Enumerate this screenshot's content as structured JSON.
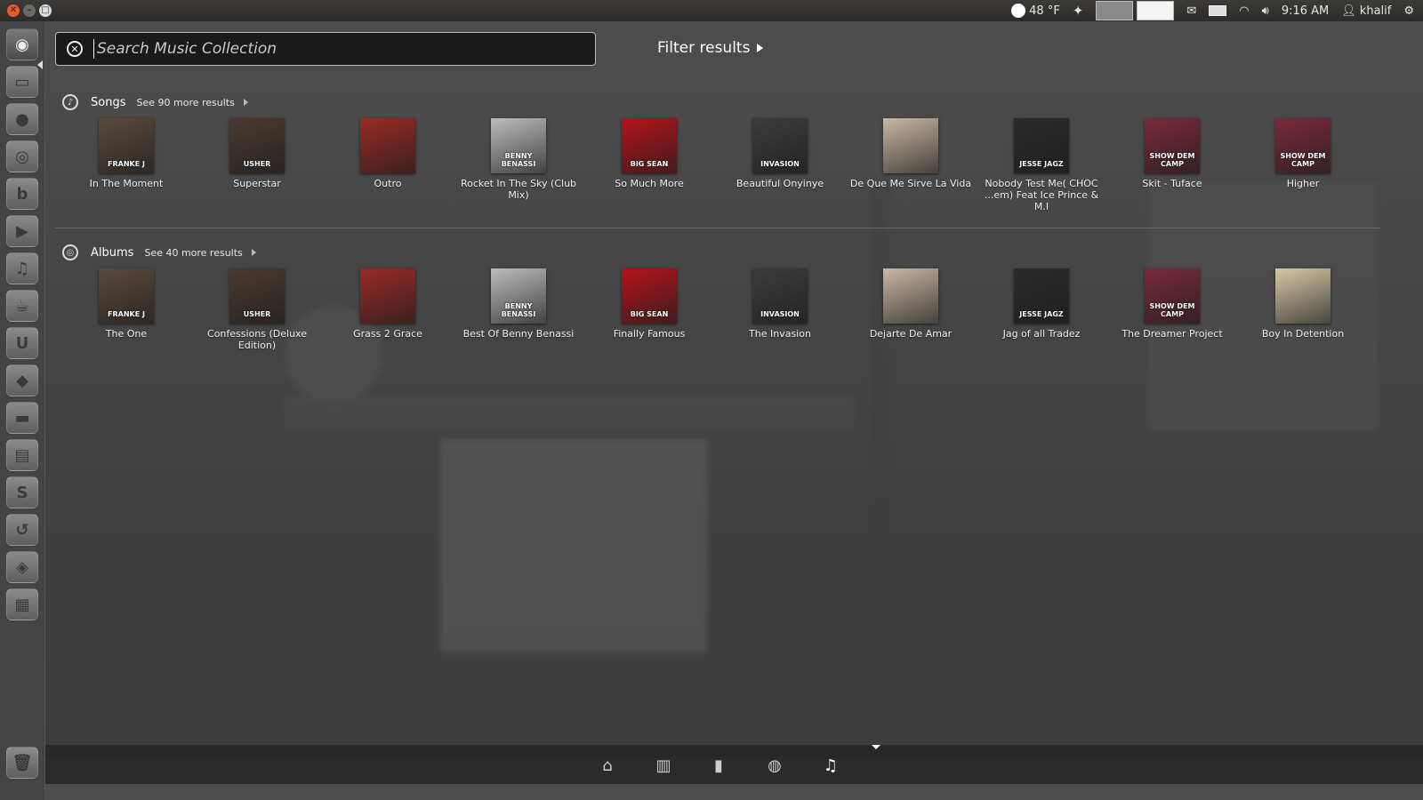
{
  "top_panel": {
    "weather": "48 °F",
    "time": "9:16 AM",
    "user": "khalif"
  },
  "search": {
    "placeholder": "Search Music Collection",
    "value": ""
  },
  "filter_results_label": "Filter results",
  "songs": {
    "title": "Songs",
    "more": "See 90 more results",
    "items": [
      {
        "label": "In The Moment",
        "cover_color": "#5a4a3c",
        "cover_text": "FRANKE J"
      },
      {
        "label": "Superstar",
        "cover_color": "#4a3a30",
        "cover_text": "USHER"
      },
      {
        "label": "Outro",
        "cover_color": "#9a2a24",
        "cover_text": ""
      },
      {
        "label": "Rocket In The Sky (Club Mix)",
        "cover_color": "#bdbdbd",
        "cover_text": "BENNY BENASSI"
      },
      {
        "label": "So Much More",
        "cover_color": "#b3141a",
        "cover_text": "BIG SEAN"
      },
      {
        "label": "Beautiful Onyinye",
        "cover_color": "#3c3c3c",
        "cover_text": "INVASION"
      },
      {
        "label": "De Que Me Sirve La Vida",
        "cover_color": "#c9b7a3",
        "cover_text": ""
      },
      {
        "label": "Nobody Test Me( CHOC ...em) Feat Ice Prince & M.I",
        "cover_color": "#2a2a2a",
        "cover_text": "JESSE JAGZ"
      },
      {
        "label": "Skit - Tuface",
        "cover_color": "#7a2a3a",
        "cover_text": "SHOW DEM CAMP"
      },
      {
        "label": "Higher",
        "cover_color": "#7a2a3a",
        "cover_text": "SHOW DEM CAMP"
      }
    ]
  },
  "albums": {
    "title": "Albums",
    "more": "See 40 more results",
    "items": [
      {
        "label": "The One",
        "cover_color": "#5a4a3c",
        "cover_text": "FRANKE J"
      },
      {
        "label": "Confessions (Deluxe Edition)",
        "cover_color": "#4a3a30",
        "cover_text": "USHER"
      },
      {
        "label": "Grass 2 Grace",
        "cover_color": "#9a2a24",
        "cover_text": ""
      },
      {
        "label": "Best Of Benny Benassi",
        "cover_color": "#bdbdbd",
        "cover_text": "BENNY BENASSI"
      },
      {
        "label": "Finally Famous",
        "cover_color": "#b3141a",
        "cover_text": "BIG SEAN"
      },
      {
        "label": "The Invasion",
        "cover_color": "#3c3c3c",
        "cover_text": "INVASION"
      },
      {
        "label": "Dejarte De Amar",
        "cover_color": "#c9b7a3",
        "cover_text": ""
      },
      {
        "label": "Jag of all Tradez",
        "cover_color": "#2a2a2a",
        "cover_text": "JESSE JAGZ"
      },
      {
        "label": "The Dreamer Project",
        "cover_color": "#7a2a3a",
        "cover_text": "SHOW DEM CAMP"
      },
      {
        "label": "Boy In Detention",
        "cover_color": "#d8c9a6",
        "cover_text": ""
      }
    ]
  },
  "launcher": {
    "items": [
      "dash",
      "files",
      "firefox",
      "chrome",
      "banshee",
      "videos",
      "headphones",
      "mug",
      "ubuntu-one",
      "software-center",
      "terminal",
      "archive",
      "skype",
      "backup",
      "screenshot",
      "workspaces",
      "trash"
    ]
  },
  "lenses": [
    "home",
    "applications",
    "files",
    "video",
    "music"
  ],
  "colors": {
    "accent": "#ffffff",
    "panel": "#3c3b37",
    "close_button": "#e45a2a"
  }
}
